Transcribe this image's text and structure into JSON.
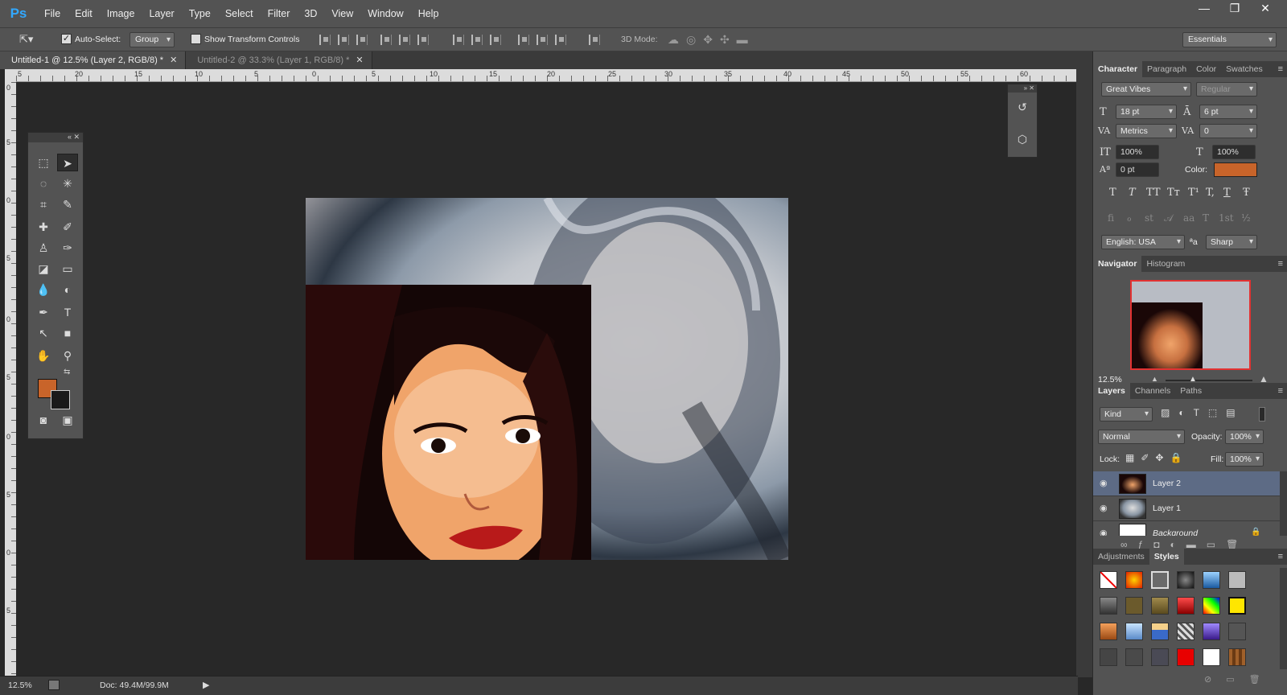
{
  "app": {
    "logo": "Ps"
  },
  "menu": [
    "File",
    "Edit",
    "Image",
    "Layer",
    "Type",
    "Select",
    "Filter",
    "3D",
    "View",
    "Window",
    "Help"
  ],
  "window_controls": {
    "minimize": "—",
    "restore": "❐",
    "close": "✕"
  },
  "options_bar": {
    "auto_select_label": "Auto-Select:",
    "auto_select_checked": true,
    "auto_select_target": "Group",
    "show_transform_label": "Show Transform Controls",
    "show_transform_checked": false,
    "mode_3d_label": "3D Mode:",
    "workspace": "Essentials"
  },
  "tabs": [
    {
      "label": "Untitled-1 @ 12.5% (Layer 2, RGB/8) *",
      "active": true,
      "close": "✕"
    },
    {
      "label": "Untitled-2 @ 33.3% (Layer 1, RGB/8) *",
      "active": false,
      "close": "✕"
    }
  ],
  "ruler_top": [
    "5",
    "20",
    "15",
    "10",
    "5",
    "0",
    "5",
    "10",
    "15",
    "20",
    "25",
    "30",
    "35",
    "40",
    "45",
    "50",
    "55",
    "60"
  ],
  "ruler_left": [
    "0",
    "5",
    "0",
    "5",
    "0",
    "5",
    "0",
    "5",
    "0",
    "5"
  ],
  "status": {
    "zoom": "12.5%",
    "doc": "Doc: 49.4M/99.9M"
  },
  "character": {
    "tabs": [
      "Character",
      "Paragraph",
      "Color",
      "Swatches"
    ],
    "font_family": "Great Vibes",
    "font_style": "Regular",
    "font_size": "18 pt",
    "leading": "6 pt",
    "kerning": "Metrics",
    "tracking": "0",
    "vscale": "100%",
    "hscale": "100%",
    "baseline": "0 pt",
    "color_label": "Color:",
    "color": "#c8642a",
    "language": "English: USA",
    "antialias": "Sharp",
    "aa_label": "ªa",
    "style_glyphs": [
      "T",
      "T",
      "TT",
      "Tт",
      "T¹",
      "T,",
      "T",
      "Ŧ"
    ],
    "opentype_glyphs": [
      "fi",
      "ℴ",
      "st",
      "𝒜",
      "aa",
      "T",
      "1st",
      "½"
    ]
  },
  "navigator": {
    "tabs": [
      "Navigator",
      "Histogram"
    ],
    "zoom": "12.5%"
  },
  "layers": {
    "tabs": [
      "Layers",
      "Channels",
      "Paths"
    ],
    "filter": "Kind",
    "blend": "Normal",
    "opacity_label": "Opacity:",
    "opacity": "100%",
    "lock_label": "Lock:",
    "fill_label": "Fill:",
    "fill": "100%",
    "items": [
      {
        "name": "Layer 2",
        "selected": true
      },
      {
        "name": "Layer 1",
        "selected": false
      },
      {
        "name": "Background",
        "selected": false
      }
    ]
  },
  "styles": {
    "tabs": [
      "Adjustments",
      "Styles"
    ]
  }
}
